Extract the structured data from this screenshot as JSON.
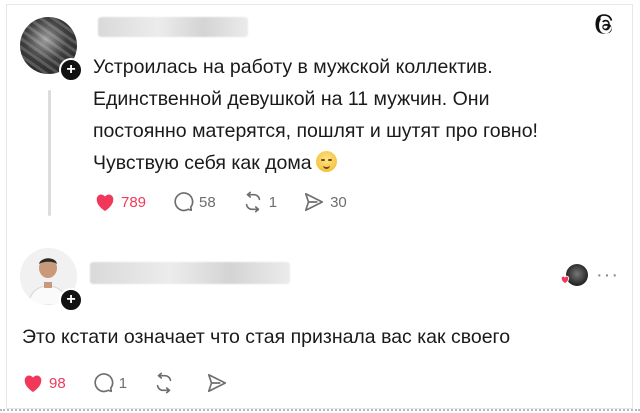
{
  "post": {
    "lines": [
      "Устроилась на работу в мужской коллектив.",
      "Единственной девушкой на 11 мужчин. Они",
      "постоянно матерятся, пошлят и шутят про говно!",
      "Чувствую себя как дома"
    ],
    "emoji": "smiling-face-with-tear-emoji",
    "likes": "789",
    "comments": "58",
    "reposts": "1",
    "shares": "30"
  },
  "reply": {
    "text": "Это кстати означает что стая признала вас как своего",
    "likes": "98",
    "comments": "1"
  },
  "colors": {
    "like_red": "#f1385a",
    "muted": "#6e6e6e"
  }
}
